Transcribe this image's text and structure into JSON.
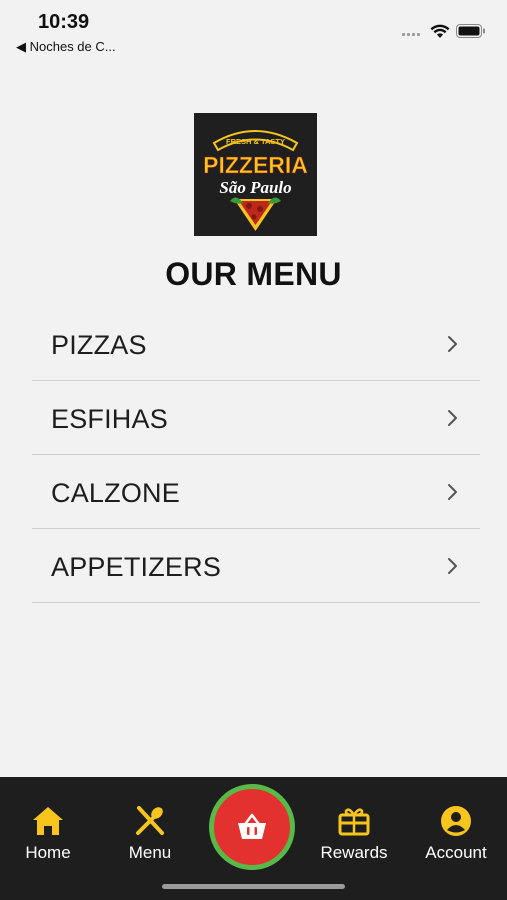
{
  "status_bar": {
    "time": "10:39",
    "back_app": "◀ Noches de C..."
  },
  "logo": {
    "top_text": "FRESH & TASTY",
    "name_line1": "PIZZERIA",
    "name_line2": "São Paulo"
  },
  "page_title": "OUR MENU",
  "menu": {
    "items": [
      {
        "label": "PIZZAS"
      },
      {
        "label": "ESFIHAS"
      },
      {
        "label": "CALZONE"
      },
      {
        "label": "APPETIZERS"
      }
    ]
  },
  "tabs": {
    "home": "Home",
    "menu": "Menu",
    "rewards": "Rewards",
    "account": "Account"
  },
  "colors": {
    "accent_yellow": "#f7c51e",
    "cart_red": "#e3312f",
    "cart_ring_green": "#57b947",
    "tabbar_bg": "#1e1e1e",
    "page_bg": "#f2f2f2"
  },
  "icons": {
    "home": "home-icon",
    "menu": "fork-knife-icon",
    "cart": "basket-icon",
    "rewards": "gift-card-icon",
    "account": "user-circle-icon"
  }
}
